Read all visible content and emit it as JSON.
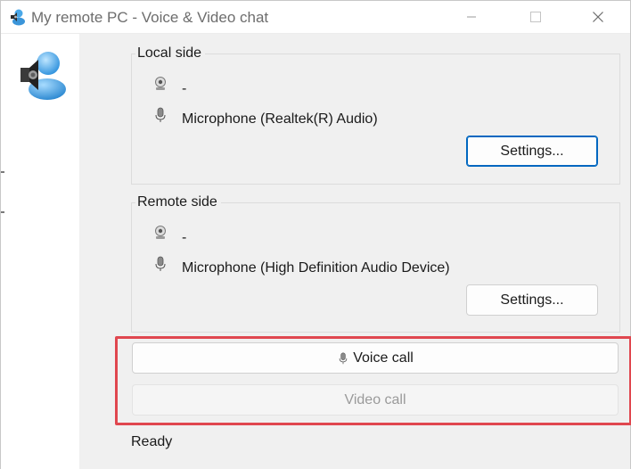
{
  "window": {
    "title": "My remote PC - Voice & Video chat",
    "controls": [
      "minimize-icon",
      "maximize-icon",
      "close-icon"
    ]
  },
  "local": {
    "label": "Local side",
    "camera": "-",
    "microphone": "Microphone (Realtek(R) Audio)",
    "settings_label": "Settings..."
  },
  "remote": {
    "label": "Remote side",
    "camera": "-",
    "microphone": "Microphone (High Definition Audio Device)",
    "settings_label": "Settings..."
  },
  "actions": {
    "voice_call_label": "Voice call",
    "video_call_label": "Video call"
  },
  "status": "Ready",
  "colors": {
    "highlight": "#e0474f",
    "focus_border": "#0067c0",
    "window_bg": "#f0f0f0"
  }
}
